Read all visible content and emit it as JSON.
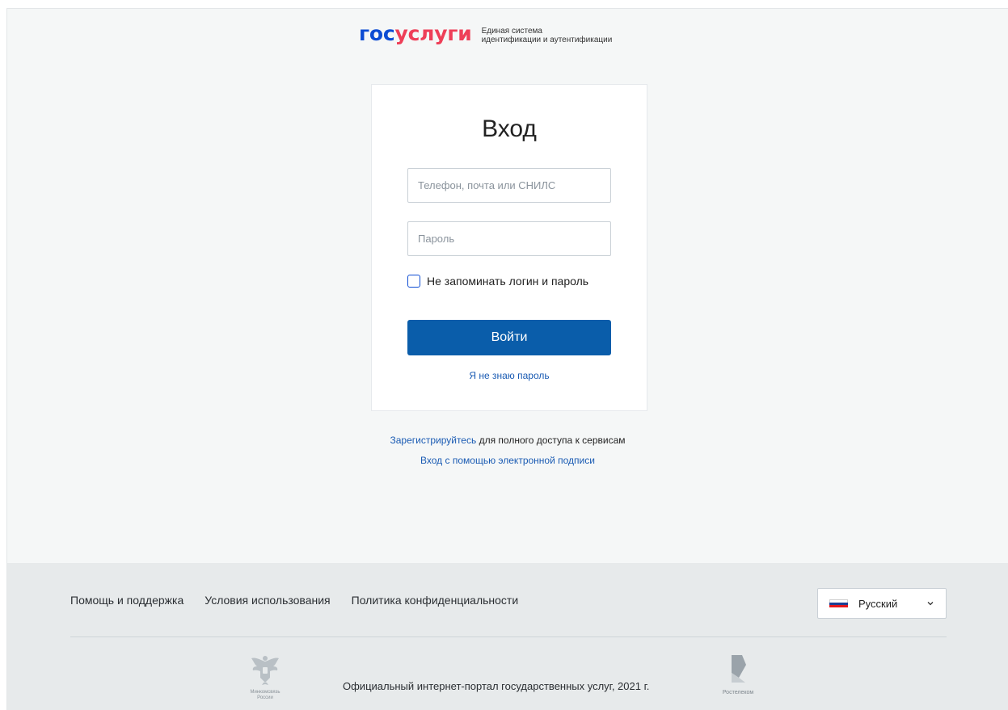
{
  "header": {
    "logo_gos": "гос",
    "logo_uslugi": "услуги",
    "tagline_line1": "Единая система",
    "tagline_line2": "идентификации и аутентификации"
  },
  "login_card": {
    "title": "Вход",
    "login_placeholder": "Телефон, почта или СНИЛС",
    "password_placeholder": "Пароль",
    "remember_label": "Не запоминать логин и пароль",
    "remember_checked": false,
    "submit_label": "Войти",
    "forgot_link": "Я не знаю пароль"
  },
  "below_card": {
    "register_link": "Зарегистрируйтесь",
    "register_text": " для полного доступа к сервисам",
    "esign_link": "Вход с помощью электронной подписи"
  },
  "footer": {
    "links": [
      {
        "label": "Помощь и поддержка"
      },
      {
        "label": "Условия использования"
      },
      {
        "label": "Политика конфиденциальности"
      }
    ],
    "language": "Русский",
    "copyright": "Официальный интернет-портал государственных услуг, 2021 г.",
    "emblem_caption_line1": "Минкомсвязь",
    "emblem_caption_line2": "России",
    "rt_caption": "Ростелеком"
  },
  "icons": {
    "flag": "russia-flag-icon",
    "chevron": "chevron-down-icon",
    "emblem": "coat-of-arms-icon",
    "rt": "rostelecom-logo"
  },
  "colors": {
    "brand_blue": "#0d4cd3",
    "brand_red": "#ee3f58",
    "button": "#0a5daa",
    "link": "#1a5bb3"
  }
}
